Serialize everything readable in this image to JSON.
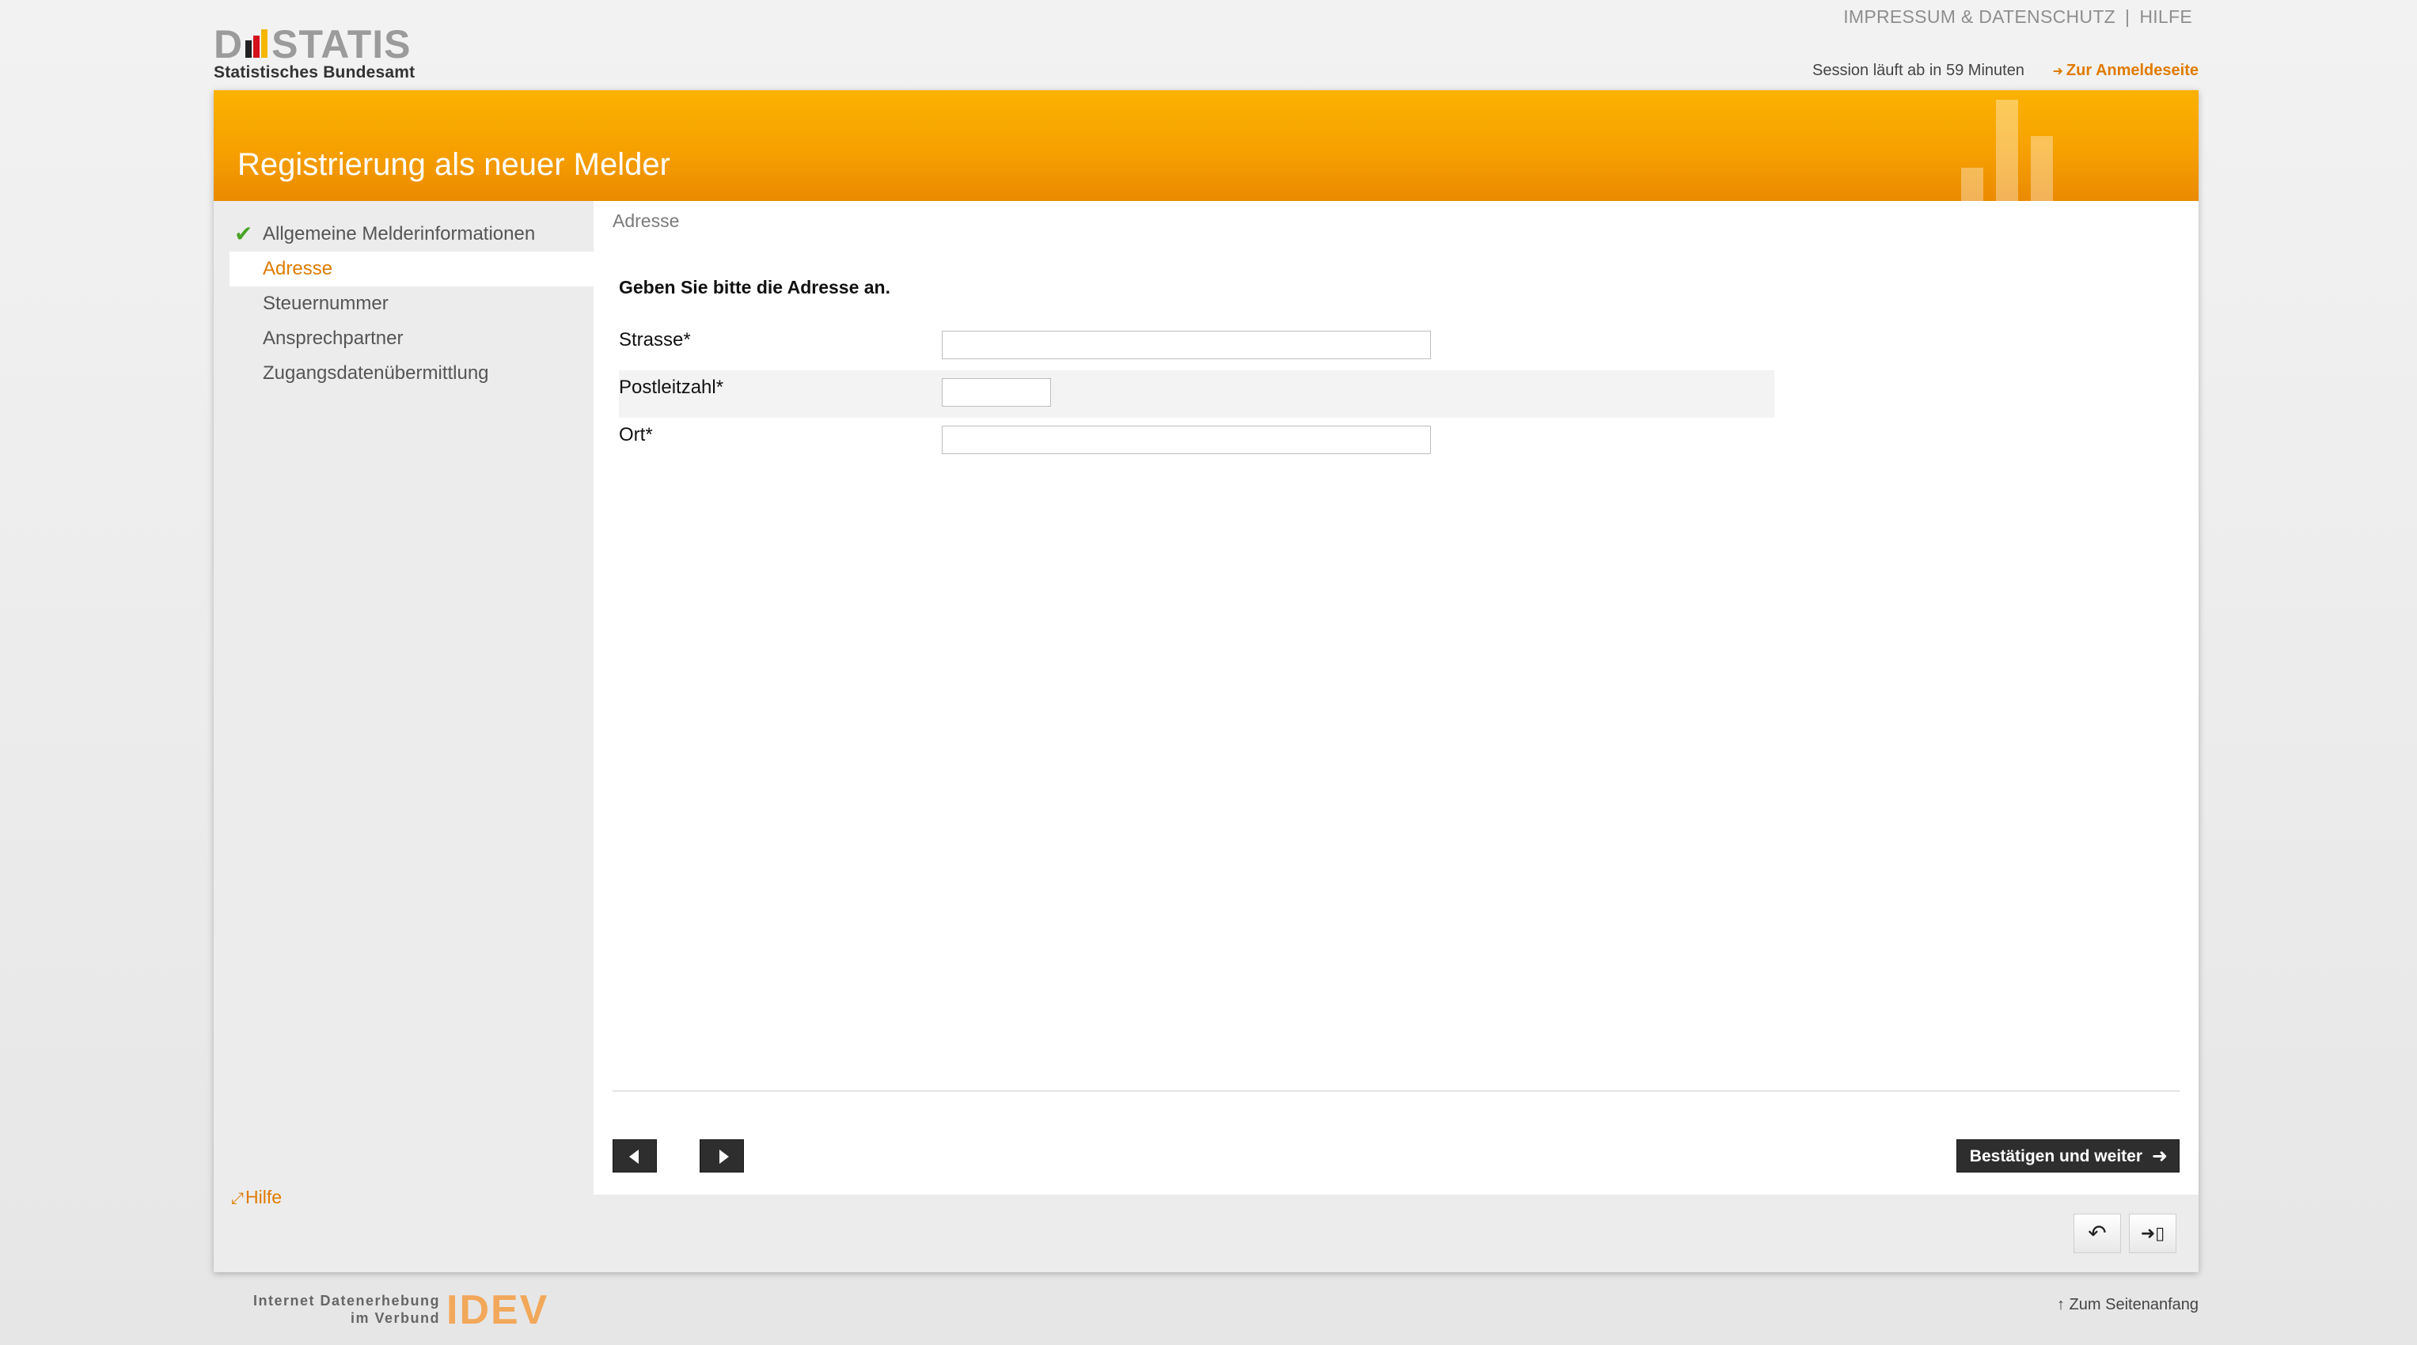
{
  "brand": {
    "logo_text_left": "D",
    "logo_text_right": "STATIS",
    "logo_subtitle": "Statistisches Bundesamt",
    "footer_line1": "Internet Datenerhebung",
    "footer_line2": "im Verbund",
    "footer_mark": "IDEV",
    "accent_color": "#f6a000",
    "link_color": "#e07b00"
  },
  "top_links": {
    "impressum": "IMPRESSUM & DATENSCHUTZ",
    "separator": "|",
    "hilfe": "HILFE"
  },
  "session": {
    "text": "Session läuft ab in 59 Minuten",
    "login_link": "Zur Anmeldeseite",
    "arrow": "➜"
  },
  "banner": {
    "title": "Registrierung als neuer Melder"
  },
  "sidebar": {
    "items": [
      {
        "label": "Allgemeine Melderinformationen",
        "state": "done"
      },
      {
        "label": "Adresse",
        "state": "active"
      },
      {
        "label": "Steuernummer",
        "state": "pending"
      },
      {
        "label": "Ansprechpartner",
        "state": "pending"
      },
      {
        "label": "Zugangsdatenübermittlung",
        "state": "pending"
      }
    ],
    "check_icon": "✔",
    "help_label": "Hilfe",
    "help_icon": "⤢"
  },
  "content": {
    "breadcrumb": "Adresse",
    "instruction": "Geben Sie bitte die Adresse an.",
    "fields": [
      {
        "label": "Strasse*",
        "value": "",
        "placeholder": ""
      },
      {
        "label": "Postleitzahl*",
        "value": "",
        "placeholder": ""
      },
      {
        "label": "Ort*",
        "value": "",
        "placeholder": ""
      }
    ],
    "confirm_label": "Bestätigen und weiter",
    "confirm_arrow": "➜"
  },
  "toolbar": {
    "undo_icon": "↶",
    "exit_icon": "➜▯"
  },
  "footer": {
    "top_link": "↑ Zum Seitenanfang"
  }
}
